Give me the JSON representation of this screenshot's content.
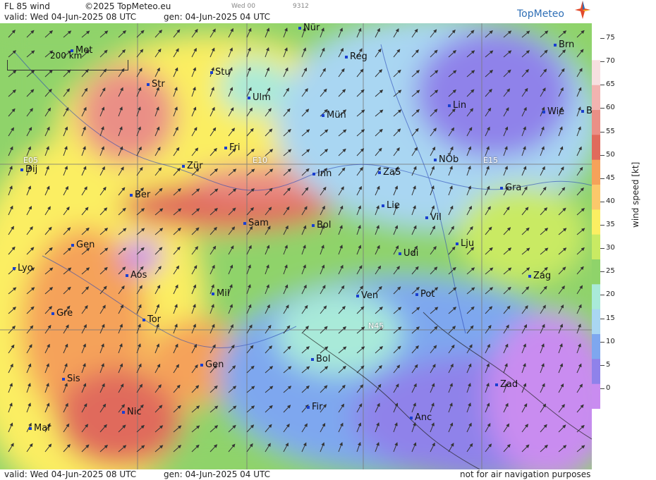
{
  "header": {
    "product": "FL 85 wind",
    "copyright": "©2025 TopMeteo.eu",
    "valid_label": "valid:  Wed  04-Jun-2025  08 UTC",
    "gen_label": "gen: 04-Jun-2025  04 UTC",
    "run_label": "Wed 00",
    "code_label": "9312",
    "brand": "TopMeteo"
  },
  "map": {
    "scale_label": "200 km",
    "grid_labels": [
      "E05",
      "E10",
      "E15",
      "N45"
    ],
    "cities": [
      "Nür",
      "Met",
      "Reg",
      "Brn",
      "Stu",
      "Str",
      "Ulm",
      "Lin",
      "Wie",
      "B",
      "Mün",
      "Fri",
      "Dij",
      "Zür",
      "E10",
      "Inn",
      "ZaS",
      "NÖb",
      "Gra",
      "Ber",
      "Lie",
      "Vil",
      "Sam",
      "Bol",
      "Lju",
      "Gen",
      "Udi",
      "Lyo",
      "Aos",
      "Zag",
      "Mil",
      "Ven",
      "Pot",
      "Gre",
      "Tor",
      "Gen",
      "Bol",
      "Sis",
      "Zad",
      "Nic",
      "Fir",
      "Anc",
      "Mar"
    ]
  },
  "legend": {
    "ticks": [
      "75",
      "70",
      "65",
      "60",
      "55",
      "50",
      "45",
      "40",
      "35",
      "30",
      "25",
      "20",
      "15",
      "10",
      "5",
      "0"
    ],
    "unit_label": "wind speed  [kt]",
    "colors": [
      "#ffffff",
      "#f7dfe0",
      "#f2b3b0",
      "#ea8f86",
      "#e06a5c",
      "#f5a25a",
      "#fbc86b",
      "#fbee62",
      "#c9ea63",
      "#8fd36a",
      "#a9ead9",
      "#a9d6f2",
      "#7ea7ef",
      "#8f82ea",
      "#c98cf0"
    ]
  },
  "footer": {
    "valid_label": "valid:  Wed  04-Jun-2025  08 UTC",
    "gen_label": "gen: 04-Jun-2025  04 UTC",
    "notice": "not for air navigation purposes"
  }
}
